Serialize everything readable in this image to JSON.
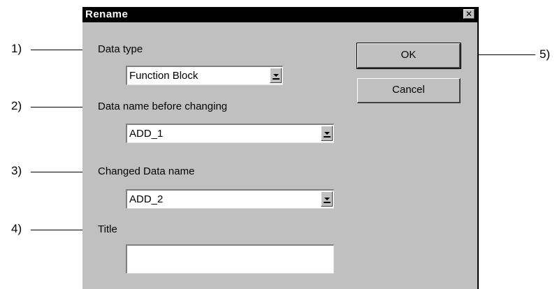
{
  "dialog": {
    "title": "Rename",
    "close_glyph": "✕",
    "fields": {
      "data_type": {
        "label": "Data type",
        "value": "Function Block"
      },
      "data_name_before": {
        "label": "Data name before changing",
        "value": "ADD_1"
      },
      "changed_data_name": {
        "label": "Changed Data name",
        "value": "ADD_2"
      },
      "title": {
        "label": "Title",
        "value": ""
      }
    },
    "buttons": {
      "ok": "OK",
      "cancel": "Cancel"
    }
  },
  "annotations": [
    "1)",
    "2)",
    "3)",
    "4)",
    "5)"
  ]
}
